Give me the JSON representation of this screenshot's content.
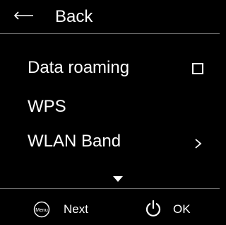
{
  "header": {
    "back_label": "Back",
    "back_icon": "back-arrow-icon"
  },
  "menu": {
    "items": [
      {
        "label": "Data roaming",
        "control": "checkbox",
        "checked": false
      },
      {
        "label": "WPS",
        "control": "none"
      },
      {
        "label": "WLAN Band",
        "control": "chevron-right-icon"
      }
    ],
    "more_below_icon": "chevron-down-icon"
  },
  "footer": {
    "menu_key_icon_text": "Menu",
    "next_label": "Next",
    "power_icon": "power-icon",
    "ok_label": "OK"
  },
  "colors": {
    "background": "#000000",
    "foreground": "#ffffff",
    "divider": "#6b6b6b"
  }
}
